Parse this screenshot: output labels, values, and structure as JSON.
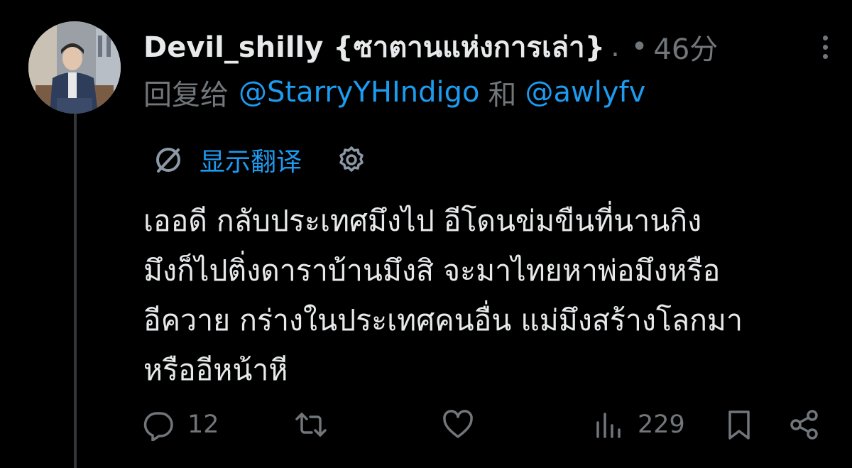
{
  "tweet": {
    "display_name": "Devil_shilly {ซาตานแห่งการเล่า}",
    "ellipsis": ".",
    "separator": "•",
    "time": "46分",
    "reply_prefix": "回复给",
    "reply_to": [
      "@StarryYHIndigo",
      "@awlyfv"
    ],
    "reply_joiner": "和",
    "translate_label": "显示翻译",
    "text_lines": [
      "เออดี กลับประเทศมึงไป อีโดนข่มขืนที่นานกิง",
      "มึงก็ไปติ่งดาราบ้านมึงสิ จะมาไทยหาพ่อมึงหรือ",
      "อีควาย กร่างในประเทศคนอื่น แม่มึงสร้างโลกมา",
      "หรืออีหน้าหี"
    ]
  },
  "actions": {
    "replies": "12",
    "retweets": "",
    "likes": "",
    "views": "229"
  },
  "icons": {
    "reply": "speech-bubble-icon",
    "retweet": "retweet-icon",
    "like": "heart-icon",
    "views": "bar-chart-icon",
    "bookmark": "bookmark-icon",
    "share": "share-icon",
    "translate": "translate-icon",
    "settings": "gear-icon",
    "more": "more-icon"
  },
  "colors": {
    "background": "#000000",
    "text": "#e7e9ea",
    "muted": "#71767b",
    "accent": "#1d9bf0",
    "thread_line": "#333639"
  }
}
